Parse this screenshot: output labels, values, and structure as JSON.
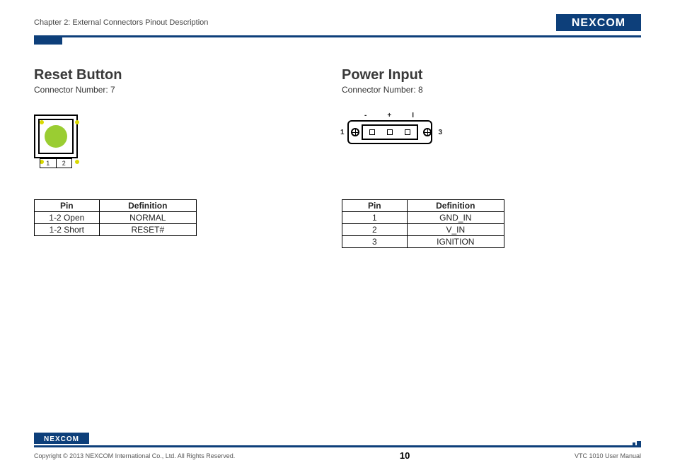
{
  "header": {
    "chapter": "Chapter 2: External Connectors Pinout Description",
    "logo_text": "NEXCOM"
  },
  "left": {
    "title": "Reset Button",
    "subtitle": "Connector Number: 7",
    "pin_labels": {
      "p1": "1",
      "p2": "2"
    },
    "table": {
      "headers": {
        "pin": "Pin",
        "def": "Definition"
      },
      "rows": [
        {
          "pin": "1-2 Open",
          "def": "NORMAL"
        },
        {
          "pin": "1-2 Short",
          "def": "RESET#"
        }
      ]
    }
  },
  "right": {
    "title": "Power Input",
    "subtitle": "Connector Number: 8",
    "top_labels": {
      "a": "-",
      "b": "+",
      "c": "I"
    },
    "side_labels": {
      "left": "1",
      "right": "3"
    },
    "table": {
      "headers": {
        "pin": "Pin",
        "def": "Definition"
      },
      "rows": [
        {
          "pin": "1",
          "def": "GND_IN"
        },
        {
          "pin": "2",
          "def": "V_IN"
        },
        {
          "pin": "3",
          "def": "IGNITION"
        }
      ]
    }
  },
  "footer": {
    "copyright": "Copyright © 2013 NEXCOM International Co., Ltd. All Rights Reserved.",
    "page": "10",
    "manual": "VTC 1010 User Manual",
    "logo_text": "NEXCOM"
  }
}
